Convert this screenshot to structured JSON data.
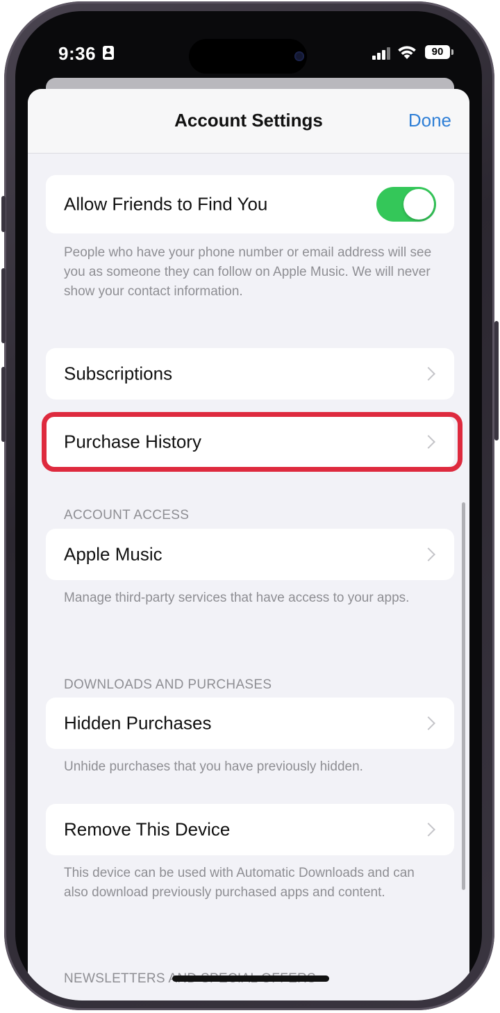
{
  "status_bar": {
    "time": "9:36",
    "battery": "90"
  },
  "nav": {
    "title": "Account Settings",
    "done_label": "Done"
  },
  "friends": {
    "label": "Allow Friends to Find You",
    "enabled": true,
    "footer": "People who have your phone number or email address will see you as someone they can follow on Apple Music. We will never show your contact information."
  },
  "rows": {
    "subscriptions": "Subscriptions",
    "purchase_history": "Purchase History"
  },
  "account_access": {
    "header": "ACCOUNT ACCESS",
    "apple_music": "Apple Music",
    "footer": "Manage third-party services that have access to your apps."
  },
  "downloads": {
    "header": "DOWNLOADS AND PURCHASES",
    "hidden_purchases": "Hidden Purchases",
    "footer": "Unhide purchases that you have previously hidden."
  },
  "remove_device": {
    "label": "Remove This Device",
    "footer": "This device can be used with Automatic Downloads and can also download previously purchased apps and content."
  },
  "newsletters": {
    "header": "NEWSLETTERS AND SPECIAL OFFERS"
  },
  "colors": {
    "toggle_on": "#34c759",
    "link_blue": "#2f7fd6",
    "highlight_red": "#de2a3e"
  }
}
